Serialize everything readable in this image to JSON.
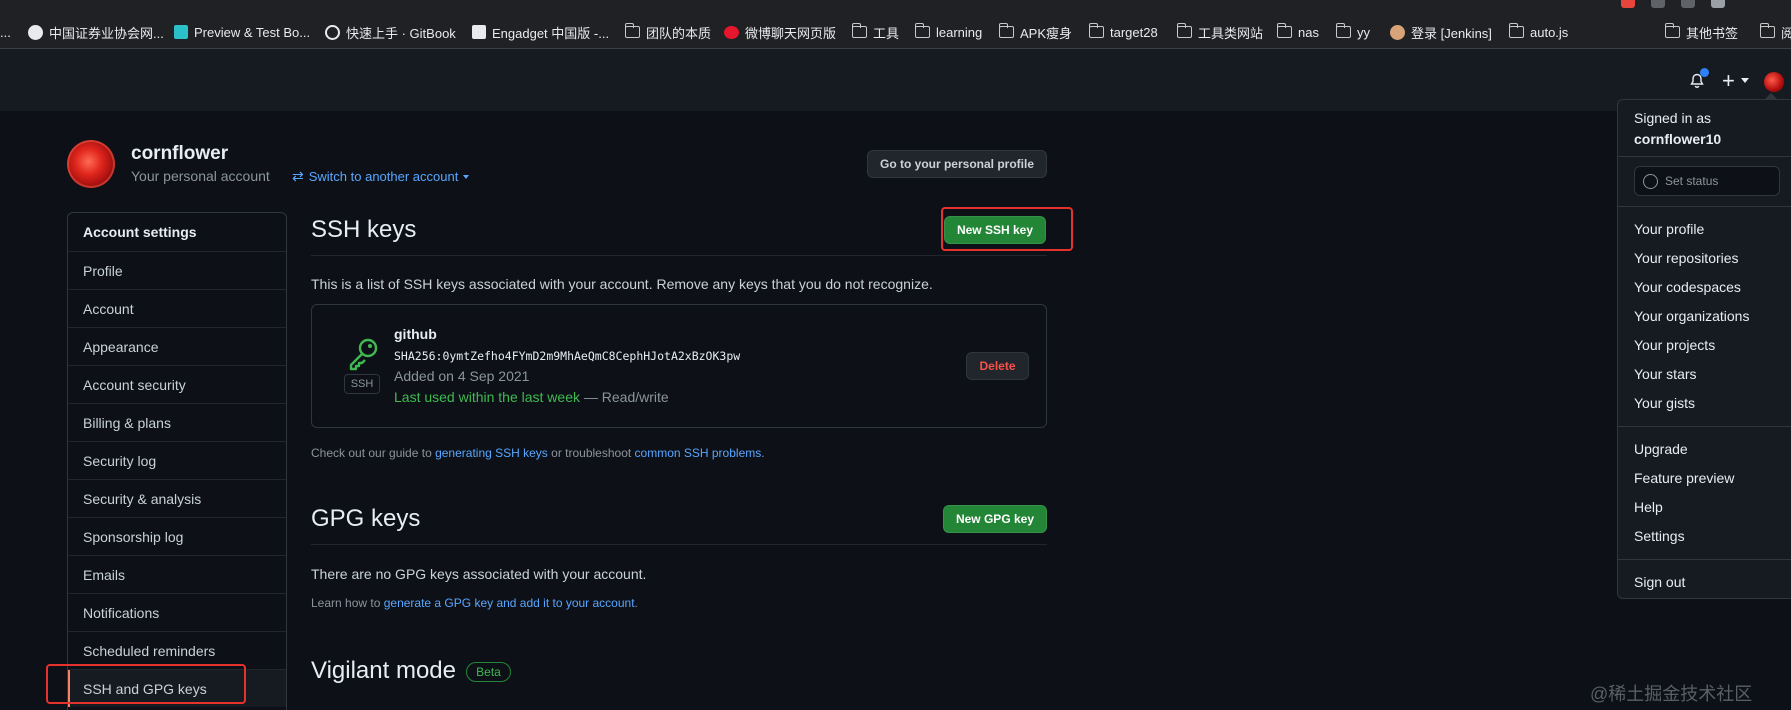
{
  "browser": {
    "bookmarks": [
      {
        "label": "...",
        "icon": "folder-icon"
      },
      {
        "label": "中国证券业协会网...",
        "icon": "globe-icon"
      },
      {
        "label": "Preview & Test Bo...",
        "icon": "app-icon"
      },
      {
        "label": "快速上手 · GitBook",
        "icon": "wordpress-icon"
      },
      {
        "label": "Engadget 中国版 -...",
        "icon": "engadget-icon"
      },
      {
        "label": "团队的本质",
        "icon": "folder-icon"
      },
      {
        "label": "微博聊天网页版",
        "icon": "weibo-icon"
      },
      {
        "label": "工具",
        "icon": "folder-icon"
      },
      {
        "label": "learning",
        "icon": "folder-icon"
      },
      {
        "label": "APK瘦身",
        "icon": "folder-icon"
      },
      {
        "label": "target28",
        "icon": "folder-icon"
      },
      {
        "label": "工具类网站",
        "icon": "folder-icon"
      },
      {
        "label": "nas",
        "icon": "folder-icon"
      },
      {
        "label": "yy",
        "icon": "folder-icon"
      },
      {
        "label": "登录 [Jenkins]",
        "icon": "jenkins-icon"
      },
      {
        "label": "auto.js",
        "icon": "folder-icon"
      },
      {
        "label": "其他书签",
        "icon": "folder-icon"
      },
      {
        "label": "阅",
        "icon": "reading-list-icon"
      }
    ]
  },
  "profile": {
    "name": "cornflower",
    "subtitle": "Your personal account",
    "switch_label": "Switch to another account",
    "go_profile_label": "Go to your personal profile"
  },
  "sidebar": {
    "heading": "Account settings",
    "items": [
      {
        "label": "Profile"
      },
      {
        "label": "Account"
      },
      {
        "label": "Appearance"
      },
      {
        "label": "Account security"
      },
      {
        "label": "Billing & plans"
      },
      {
        "label": "Security log"
      },
      {
        "label": "Security & analysis"
      },
      {
        "label": "Sponsorship log"
      },
      {
        "label": "Emails"
      },
      {
        "label": "Notifications"
      },
      {
        "label": "Scheduled reminders"
      },
      {
        "label": "SSH and GPG keys"
      }
    ]
  },
  "ssh": {
    "title": "SSH keys",
    "new_button": "New SSH key",
    "description": "This is a list of SSH keys associated with your account. Remove any keys that you do not recognize.",
    "key": {
      "title": "github",
      "fingerprint": "SHA256:0ymtZefho4FYmD2m9MhAeQmC8CephHJotA2xBzOK3pw",
      "added": "Added on 4 Sep 2021",
      "last_used": "Last used within the last week",
      "access": " — Read/write",
      "badge": "SSH",
      "delete_button": "Delete"
    },
    "guide_prefix": "Check out our guide to ",
    "guide_link1": "generating SSH keys",
    "guide_middle": " or troubleshoot ",
    "guide_link2": "common SSH problems",
    "guide_suffix": "."
  },
  "gpg": {
    "title": "GPG keys",
    "new_button": "New GPG key",
    "empty": "There are no GPG keys associated with your account.",
    "learn_prefix": "Learn how to ",
    "learn_link": "generate a GPG key and add it to your account",
    "learn_suffix": "."
  },
  "vigilant": {
    "title": "Vigilant mode",
    "badge": "Beta"
  },
  "dropdown": {
    "signed_in_as": "Signed in as",
    "username": "cornflower10",
    "set_status": "Set status",
    "group1": [
      "Your profile",
      "Your repositories",
      "Your codespaces",
      "Your organizations",
      "Your projects",
      "Your stars",
      "Your gists"
    ],
    "group2": [
      "Upgrade",
      "Feature preview",
      "Help",
      "Settings"
    ],
    "sign_out": "Sign out"
  },
  "watermark": "@稀土掘金技术社区",
  "colors": {
    "page_bg": "#0d1117",
    "header_bg": "#161b22",
    "link": "#58a6ff",
    "green_button": "#238636",
    "danger": "#f85149",
    "highlight": "#e5322d"
  }
}
